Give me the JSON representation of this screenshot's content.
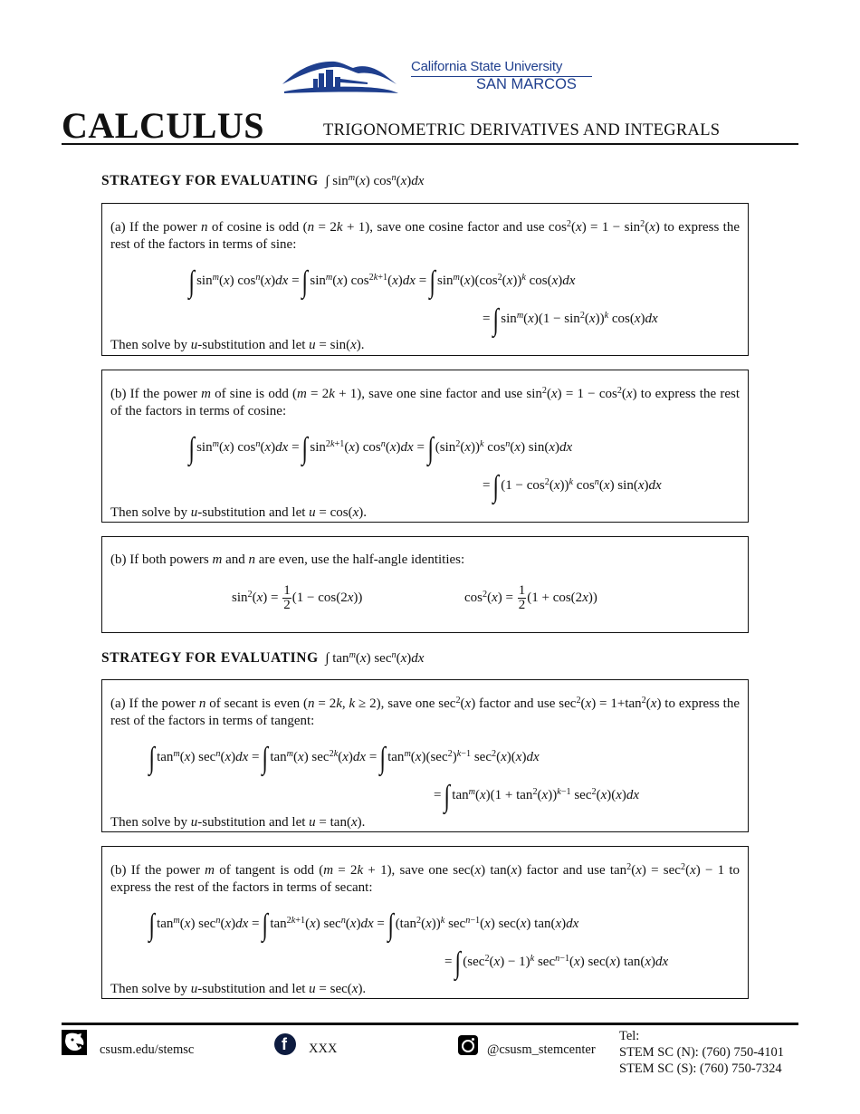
{
  "header": {
    "logo": {
      "line1": "California State University",
      "line2": "SAN MARCOS",
      "brand_color": "#1f3f8e"
    },
    "title": "CALCULUS",
    "subtitle": "TRIGONOMETRIC DERIVATIVES AND INTEGRALS"
  },
  "sections": [
    {
      "heading_bold": "STRATEGY FOR EVALUATING",
      "heading_formula": "∫ sin^m(x) cos^n(x) dx",
      "boxes": [
        {
          "label": "(a)",
          "text": "If the power n of cosine is odd (n = 2k + 1), save one cosine factor and use cos²(x) = 1 − sin²(x) to express the rest of the factors in terms of sine:",
          "equation_line1": "∫ sin^m(x) cos^n(x) dx = ∫ sin^m(x) cos^(2k+1)(x) dx = ∫ sin^m(x) (cos²(x))^k cos(x) dx",
          "equation_line2": "= ∫ sin^m(x) (1 − sin²(x))^k cos(x) dx",
          "conclusion": "Then solve by u-substitution and let u = sin(x)."
        },
        {
          "label": "(b)",
          "text": "If the power m of sine is odd (m = 2k + 1), save one sine factor and use sin²(x) = 1 − cos²(x) to express the rest of the factors in terms of cosine:",
          "equation_line1": "∫ sin^m(x) cos^n(x) dx = ∫ sin^(2k+1)(x) cos^n(x) dx = ∫ (sin²(x))^k cos^n(x) sin(x) dx",
          "equation_line2": "= ∫ (1 − cos²(x))^k cos^n(x) sin(x) dx",
          "conclusion": "Then solve by u-substitution and let u = cos(x)."
        },
        {
          "label": "(b)",
          "text": "If both powers m and n are even, use the half-angle identities:",
          "identity1": "sin²(x) = 1/2 (1 − cos(2x))",
          "identity2": "cos²(x) = 1/2 (1 + cos(2x))"
        }
      ]
    },
    {
      "heading_bold": "STRATEGY FOR EVALUATING",
      "heading_formula": "∫ tan^m(x) sec^n(x) dx",
      "boxes": [
        {
          "label": "(a)",
          "text": "If the power n of secant is even (n = 2k, k ≥ 2), save one sec²(x) factor and use sec²(x) = 1 + tan²(x) to express the rest of the factors in terms of tangent:",
          "equation_line1": "∫ tan^m(x) sec^n(x) dx = ∫ tan^m(x) sec^(2k)(x) dx = ∫ tan^m(x) (sec²)^(k−1) sec²(x)(x) dx",
          "equation_line2": "= ∫ tan^m(x) (1 + tan²(x))^(k−1) sec²(x)(x) dx",
          "conclusion": "Then solve by u-substitution and let u = tan(x)."
        },
        {
          "label": "(b)",
          "text": "If the power m of tangent is odd (m = 2k + 1), save one sec(x) tan(x) factor and use tan²(x) = sec²(x) − 1 to express the rest of the factors in terms of secant:",
          "equation_line1": "∫ tan^m(x) sec^n(x) dx = ∫ tan^(2k+1)(x) sec^n(x) dx = ∫ (tan²(x))^k sec^(n−1)(x) sec(x) tan(x) dx",
          "equation_line2": "= ∫ (sec²(x) − 1)^k sec^(n−1)(x) sec(x) tan(x) dx",
          "conclusion": "Then solve by u-substitution and let u = sec(x)."
        }
      ]
    }
  ],
  "footer": {
    "website": "csusm.edu/stemsc",
    "facebook": "XXX",
    "instagram": "@csusm_stemcenter",
    "tel_label": "Tel:",
    "tel_north": "STEM SC (N): (760) 750-4101",
    "tel_south": "STEM SC (S): (760) 750-7324",
    "icons": [
      "cougar-logo-icon",
      "facebook-icon",
      "instagram-icon"
    ]
  }
}
